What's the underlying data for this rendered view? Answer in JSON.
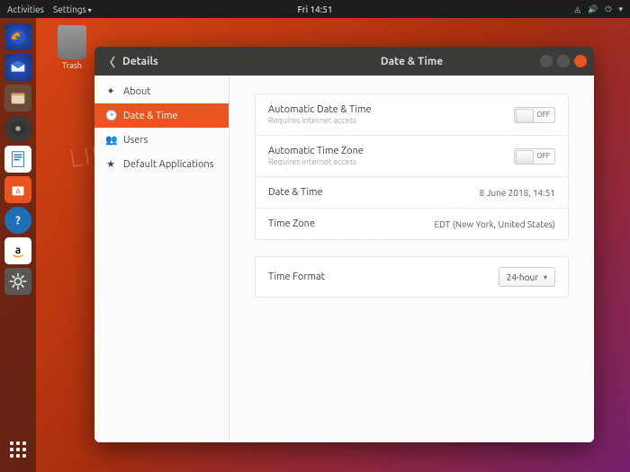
{
  "topbar": {
    "activities": "Activities",
    "app_menu": "Settings",
    "clock": "Fri 14:51"
  },
  "desktop": {
    "trash_label": "Trash"
  },
  "watermark": "LINUXCONFIG.ORG",
  "window": {
    "back_section": "Details",
    "title": "Date & Time",
    "sidebar": [
      {
        "icon": "✦",
        "label": "About"
      },
      {
        "icon": "🕑",
        "label": "Date & Time"
      },
      {
        "icon": "👥",
        "label": "Users"
      },
      {
        "icon": "★",
        "label": "Default Applications"
      }
    ],
    "active_index": 1,
    "rows": {
      "auto_datetime": {
        "title": "Automatic Date & Time",
        "sub": "Requires internet access",
        "toggle": "OFF"
      },
      "auto_tz": {
        "title": "Automatic Time Zone",
        "sub": "Requires internet access",
        "toggle": "OFF"
      },
      "datetime": {
        "title": "Date & Time",
        "value": "8 June 2018, 14:51"
      },
      "timezone": {
        "title": "Time Zone",
        "value": "EDT (New York, United States)"
      },
      "format": {
        "title": "Time Format",
        "value": "24-hour"
      }
    }
  }
}
